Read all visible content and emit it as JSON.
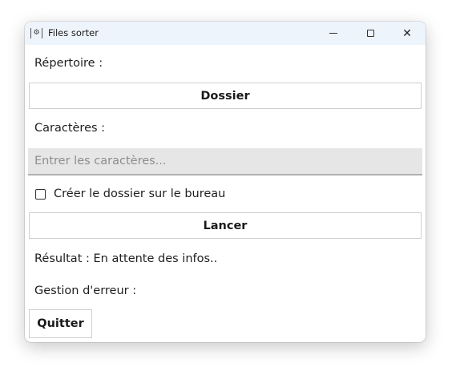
{
  "window": {
    "title": "Files sorter",
    "icon": "app-icon"
  },
  "titlebar_controls": {
    "minimize_icon": "minimize-icon",
    "maximize_icon": "maximize-icon",
    "close_icon": "close-icon",
    "close_glyph": "✕"
  },
  "form": {
    "directory_label": "Répertoire :",
    "folder_button": "Dossier",
    "characters_label": "Caractères :",
    "characters_input": {
      "value": "",
      "placeholder": "Entrer les caractères..."
    },
    "desktop_checkbox": {
      "label": "Créer le dossier sur le bureau",
      "checked": false
    },
    "run_button": "Lancer",
    "result_text": "Résultat : En attente des infos..",
    "error_text": "Gestion d'erreur :",
    "quit_button": "Quitter"
  }
}
